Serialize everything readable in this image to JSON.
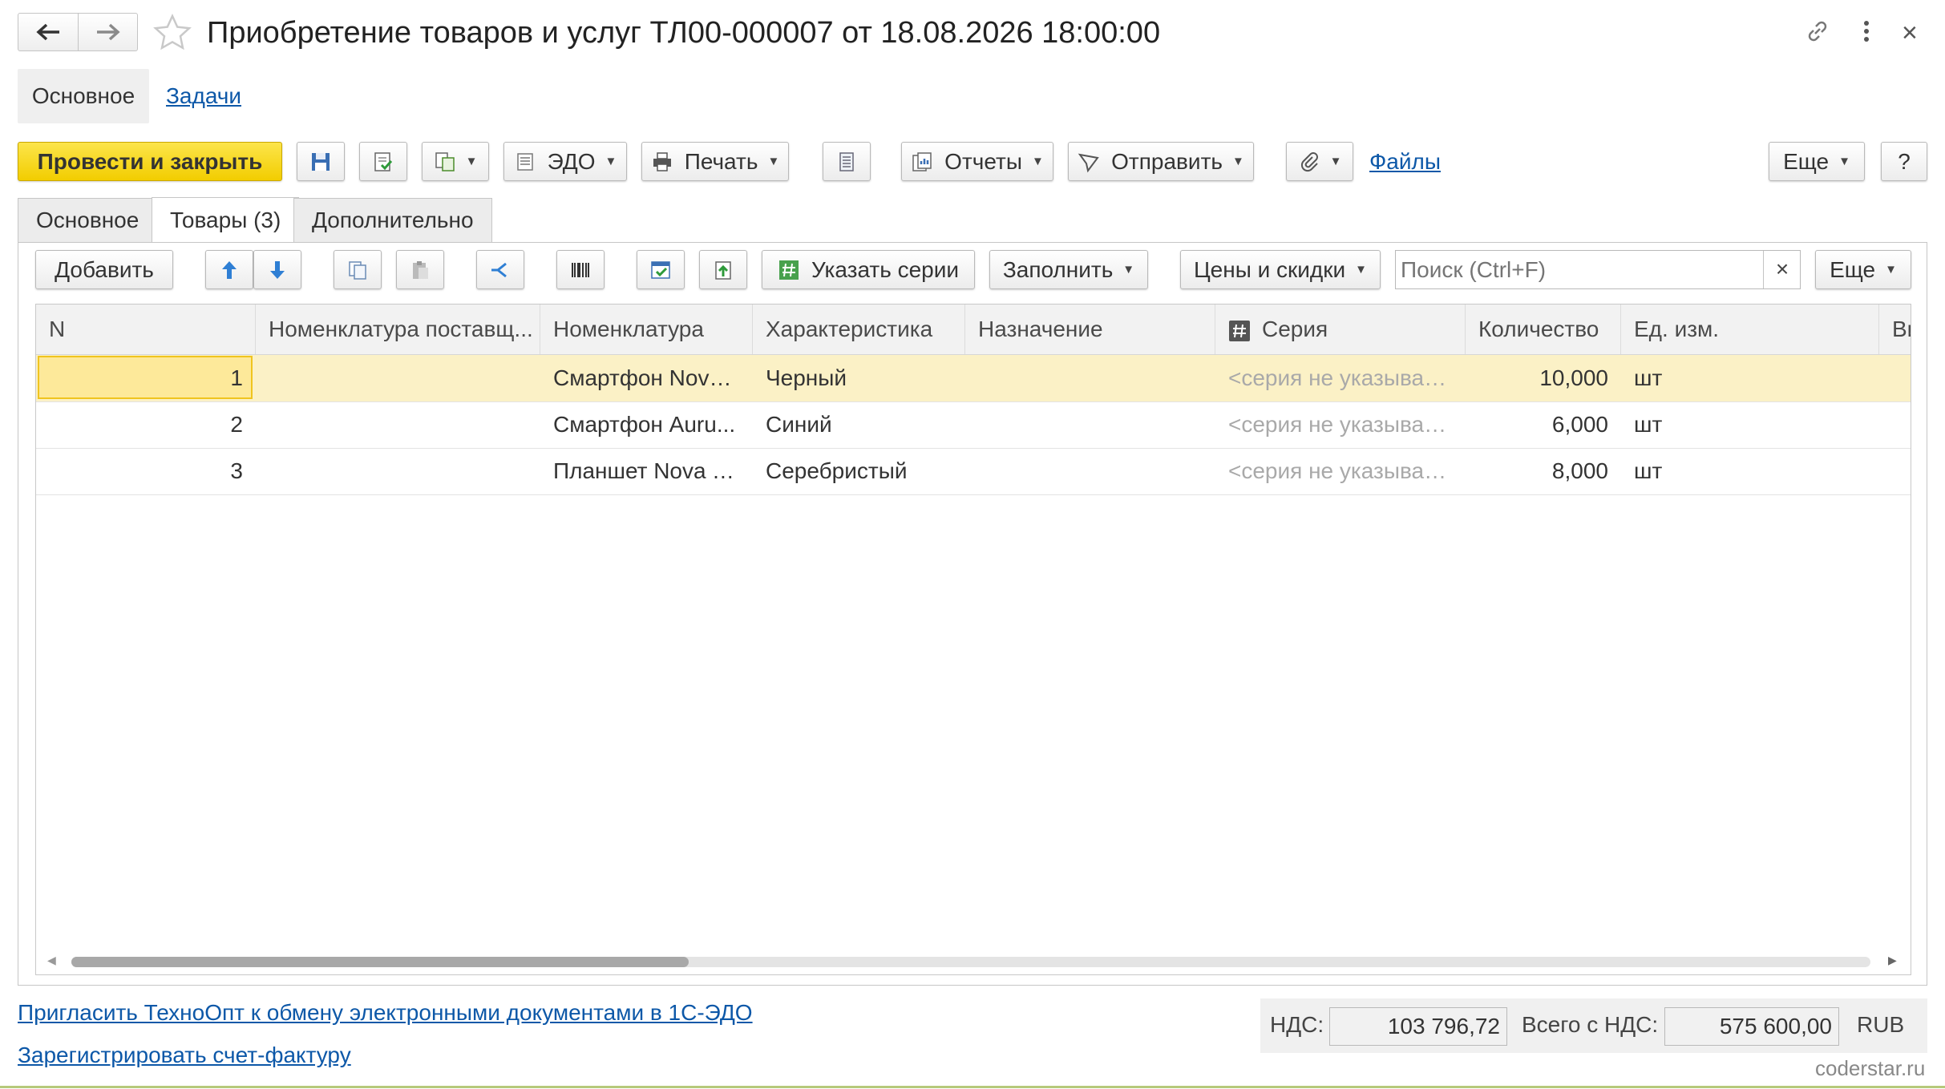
{
  "window": {
    "title": "Приобретение товаров и услуг ТЛ00-000007 от 18.08.2026 18:00:00",
    "close_glyph": "×"
  },
  "section_tabs": [
    {
      "label": "Основное"
    },
    {
      "label": "Задачи"
    }
  ],
  "toolbar": {
    "post_close": "Провести и закрыть",
    "edo": "ЭДО",
    "print": "Печать",
    "reports": "Отчеты",
    "send": "Отправить",
    "files": "Файлы",
    "more": "Еще",
    "help": "?"
  },
  "doc_tabs": [
    {
      "label": "Основное"
    },
    {
      "label": "Товары (3)"
    },
    {
      "label": "Дополнительно"
    }
  ],
  "table_toolbar": {
    "add": "Добавить",
    "series": "Указать серии",
    "fill": "Заполнить",
    "prices": "Цены и скидки",
    "search_placeholder": "Поиск (Ctrl+F)",
    "search_clear": "×",
    "more": "Еще"
  },
  "table": {
    "columns": [
      "N",
      "Номенклатура поставщ...",
      "Номенклатура",
      "Характеристика",
      "Назначение",
      "Серия",
      "Количество",
      "Ед. изм.",
      "Ви"
    ],
    "rows": [
      {
        "n": "1",
        "supplier_item": "",
        "item": "Смартфон Nova...",
        "characteristic": "Черный",
        "purpose": "",
        "series": "<серия не указывае...",
        "qty": "10,000",
        "unit": "шт"
      },
      {
        "n": "2",
        "supplier_item": "",
        "item": "Смартфон Auru...",
        "characteristic": "Синий",
        "purpose": "",
        "series": "<серия не указывае...",
        "qty": "6,000",
        "unit": "шт"
      },
      {
        "n": "3",
        "supplier_item": "",
        "item": "Планшет Nova T...",
        "characteristic": "Серебристый",
        "purpose": "",
        "series": "<серия не указывае...",
        "qty": "8,000",
        "unit": "шт"
      }
    ]
  },
  "footer": {
    "invite_link": "Пригласить ТехноОпт к обмену электронными документами в 1С-ЭДО",
    "register_link": "Зарегистрировать счет-фактуру",
    "vat_label": "НДС:",
    "vat_value": "103 796,72",
    "total_label": "Всего с НДС:",
    "total_value": "575 600,00",
    "currency": "RUB",
    "watermark": "coderstar.ru"
  },
  "colors": {
    "primary_button": "#f2cd00",
    "link": "#0d58a8",
    "selected_row": "#fbf1c6"
  }
}
